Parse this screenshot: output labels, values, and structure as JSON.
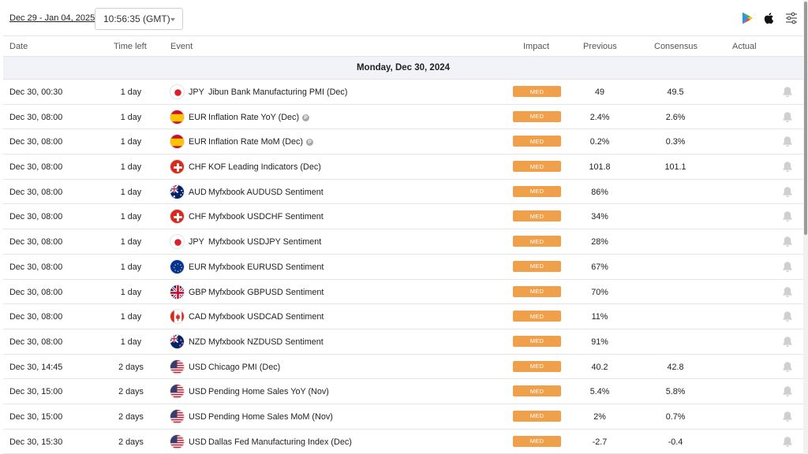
{
  "header": {
    "date_range": "Dec 29 - Jan 04, 2025",
    "time_value": "10:56:35  (GMT)",
    "icons": [
      "google-play-icon",
      "apple-icon",
      "filter-settings-icon"
    ]
  },
  "columns": {
    "date": "Date",
    "time_left": "Time left",
    "event": "Event",
    "impact": "Impact",
    "previous": "Previous",
    "consensus": "Consensus",
    "actual": "Actual"
  },
  "day_header": "Monday, Dec 30, 2024",
  "colors": {
    "impact_med": "#f0a04b",
    "day_band": "#f1f3f8"
  },
  "events": [
    {
      "date": "Dec 30, 00:30",
      "time_left": "1 day",
      "flag": "jp",
      "currency": "JPY",
      "event": "Jibun Bank Manufacturing PMI (Dec)",
      "prelim": false,
      "impact": "MED",
      "previous": "49",
      "consensus": "49.5",
      "actual": ""
    },
    {
      "date": "Dec 30, 08:00",
      "time_left": "1 day",
      "flag": "es",
      "currency": "EUR",
      "event": "Inflation Rate YoY (Dec)",
      "prelim": true,
      "impact": "MED",
      "previous": "2.4%",
      "consensus": "2.6%",
      "actual": ""
    },
    {
      "date": "Dec 30, 08:00",
      "time_left": "1 day",
      "flag": "es",
      "currency": "EUR",
      "event": "Inflation Rate MoM (Dec)",
      "prelim": true,
      "impact": "MED",
      "previous": "0.2%",
      "consensus": "0.3%",
      "actual": ""
    },
    {
      "date": "Dec 30, 08:00",
      "time_left": "1 day",
      "flag": "ch",
      "currency": "CHF",
      "event": "KOF Leading Indicators (Dec)",
      "prelim": false,
      "impact": "MED",
      "previous": "101.8",
      "consensus": "101.1",
      "actual": ""
    },
    {
      "date": "Dec 30, 08:00",
      "time_left": "1 day",
      "flag": "au",
      "currency": "AUD",
      "event": "Myfxbook AUDUSD Sentiment",
      "prelim": false,
      "impact": "MED",
      "previous": "86%",
      "consensus": "",
      "actual": ""
    },
    {
      "date": "Dec 30, 08:00",
      "time_left": "1 day",
      "flag": "ch",
      "currency": "CHF",
      "event": "Myfxbook USDCHF Sentiment",
      "prelim": false,
      "impact": "MED",
      "previous": "34%",
      "consensus": "",
      "actual": ""
    },
    {
      "date": "Dec 30, 08:00",
      "time_left": "1 day",
      "flag": "jp",
      "currency": "JPY",
      "event": "Myfxbook USDJPY Sentiment",
      "prelim": false,
      "impact": "MED",
      "previous": "28%",
      "consensus": "",
      "actual": ""
    },
    {
      "date": "Dec 30, 08:00",
      "time_left": "1 day",
      "flag": "eu",
      "currency": "EUR",
      "event": "Myfxbook EURUSD Sentiment",
      "prelim": false,
      "impact": "MED",
      "previous": "67%",
      "consensus": "",
      "actual": ""
    },
    {
      "date": "Dec 30, 08:00",
      "time_left": "1 day",
      "flag": "gb",
      "currency": "GBP",
      "event": "Myfxbook GBPUSD Sentiment",
      "prelim": false,
      "impact": "MED",
      "previous": "70%",
      "consensus": "",
      "actual": ""
    },
    {
      "date": "Dec 30, 08:00",
      "time_left": "1 day",
      "flag": "ca",
      "currency": "CAD",
      "event": "Myfxbook USDCAD Sentiment",
      "prelim": false,
      "impact": "MED",
      "previous": "11%",
      "consensus": "",
      "actual": ""
    },
    {
      "date": "Dec 30, 08:00",
      "time_left": "1 day",
      "flag": "nz",
      "currency": "NZD",
      "event": "Myfxbook NZDUSD Sentiment",
      "prelim": false,
      "impact": "MED",
      "previous": "91%",
      "consensus": "",
      "actual": ""
    },
    {
      "date": "Dec 30, 14:45",
      "time_left": "2 days",
      "flag": "us",
      "currency": "USD",
      "event": "Chicago PMI (Dec)",
      "prelim": false,
      "impact": "MED",
      "previous": "40.2",
      "consensus": "42.8",
      "actual": ""
    },
    {
      "date": "Dec 30, 15:00",
      "time_left": "2 days",
      "flag": "us",
      "currency": "USD",
      "event": "Pending Home Sales YoY (Nov)",
      "prelim": false,
      "impact": "MED",
      "previous": "5.4%",
      "consensus": "5.8%",
      "actual": ""
    },
    {
      "date": "Dec 30, 15:00",
      "time_left": "2 days",
      "flag": "us",
      "currency": "USD",
      "event": "Pending Home Sales MoM (Nov)",
      "prelim": false,
      "impact": "MED",
      "previous": "2%",
      "consensus": "0.7%",
      "actual": ""
    },
    {
      "date": "Dec 30, 15:30",
      "time_left": "2 days",
      "flag": "us",
      "currency": "USD",
      "event": "Dallas Fed Manufacturing Index (Dec)",
      "prelim": false,
      "impact": "MED",
      "previous": "-2.7",
      "consensus": "-0.4",
      "actual": ""
    }
  ]
}
